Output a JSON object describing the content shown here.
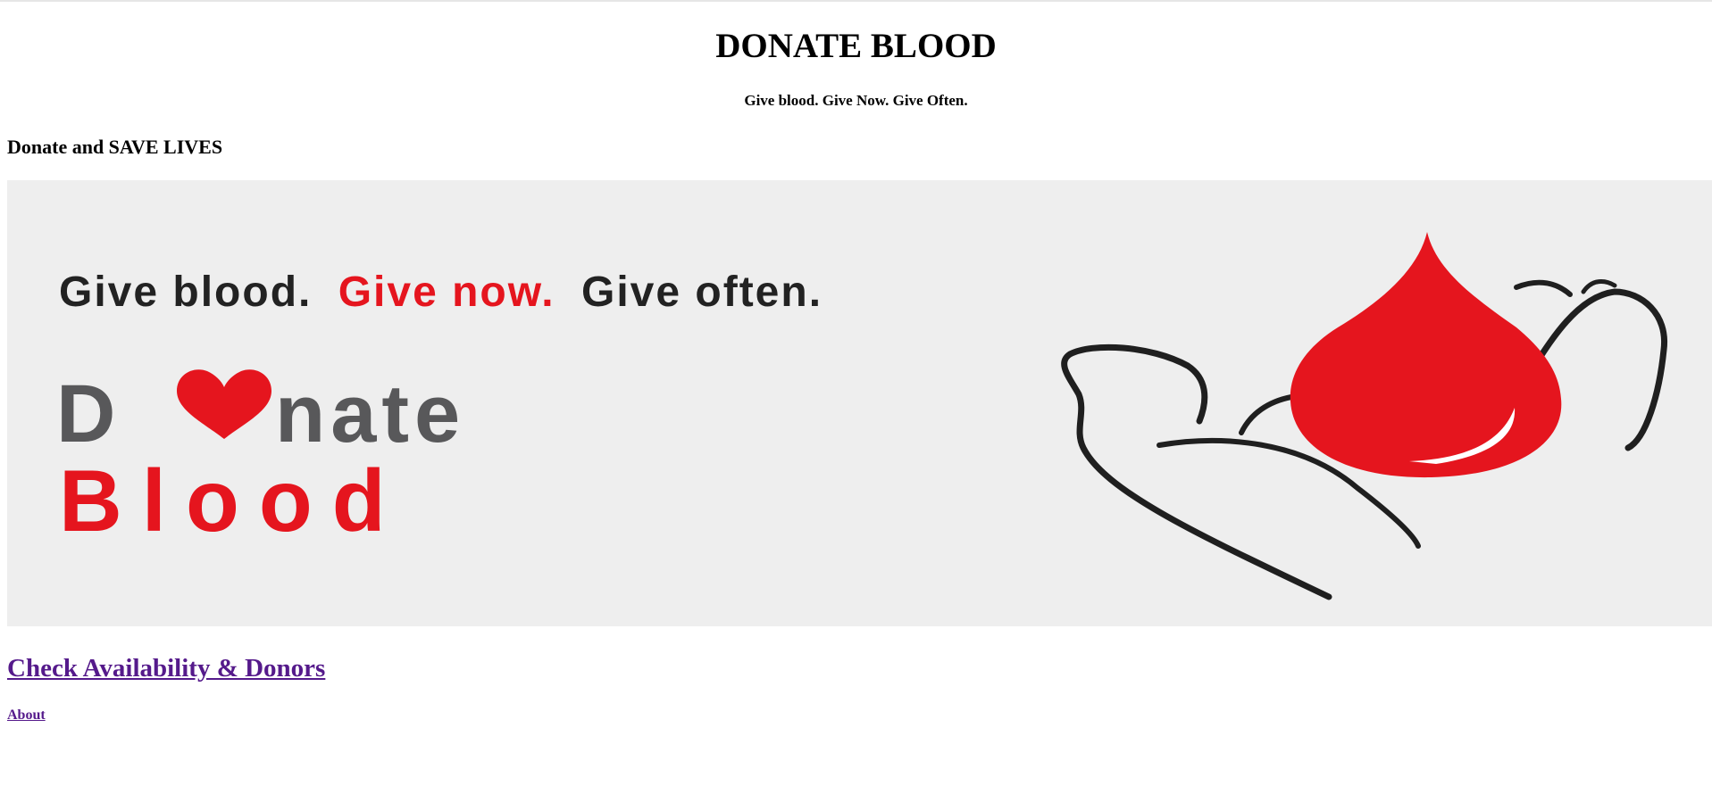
{
  "header": {
    "title": "DONATE BLOOD",
    "tagline": "Give blood. Give Now. Give Often."
  },
  "main": {
    "heading": "Donate and SAVE LIVES",
    "banner": {
      "line1_part1": "Give blood.",
      "line1_part2": "Give now.",
      "line1_part3": "Give often.",
      "word_donate_start": "D",
      "word_donate_end": "nate",
      "word_blood": "Blood",
      "colors": {
        "background": "#eeeeee",
        "red": "#e5151e",
        "dark": "#222222",
        "gray": "#58585a"
      }
    },
    "links": {
      "check": "Check Availability & Donors",
      "about": "About"
    }
  },
  "colors": {
    "visited_link": "#551a8b"
  }
}
